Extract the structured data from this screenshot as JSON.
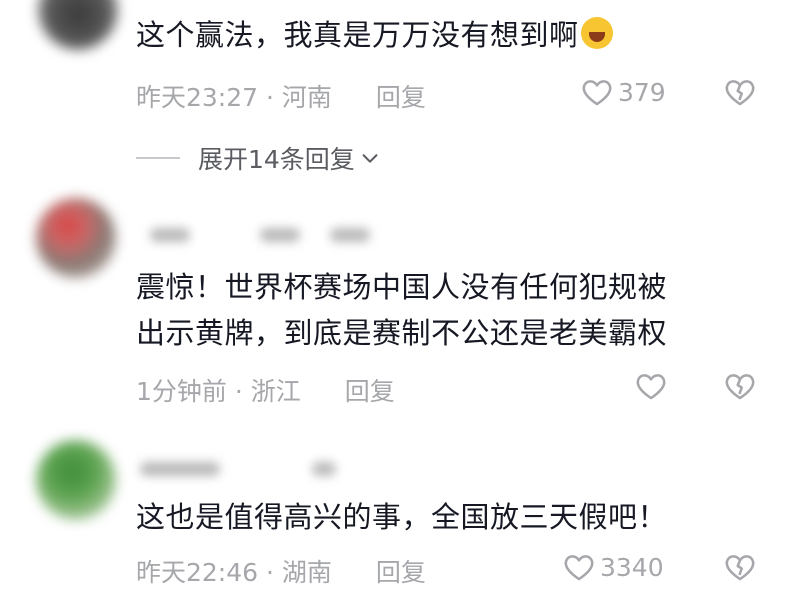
{
  "comments": [
    {
      "text": "这个赢法，我真是万万没有想到啊",
      "emoji": "laughing-crying-emoji",
      "time": "昨天23:27",
      "location": "河南",
      "reply_label": "回复",
      "likes": "379",
      "expand_label": "展开14条回复"
    },
    {
      "text_line1": "震惊！世界杯赛场中国人没有任何犯规被",
      "text_line2": "出示黄牌，到底是赛制不公还是老美霸权",
      "time": "1分钟前",
      "location": "浙江",
      "reply_label": "回复"
    },
    {
      "text": "这也是值得高兴的事，全国放三天假吧！",
      "time": "昨天22:46",
      "location": "湖南",
      "reply_label": "回复",
      "likes": "3340"
    }
  ],
  "separator": "·",
  "icons": {
    "like": "heart-outline-icon",
    "dislike": "broken-heart-icon",
    "expand": "chevron-down-icon"
  }
}
